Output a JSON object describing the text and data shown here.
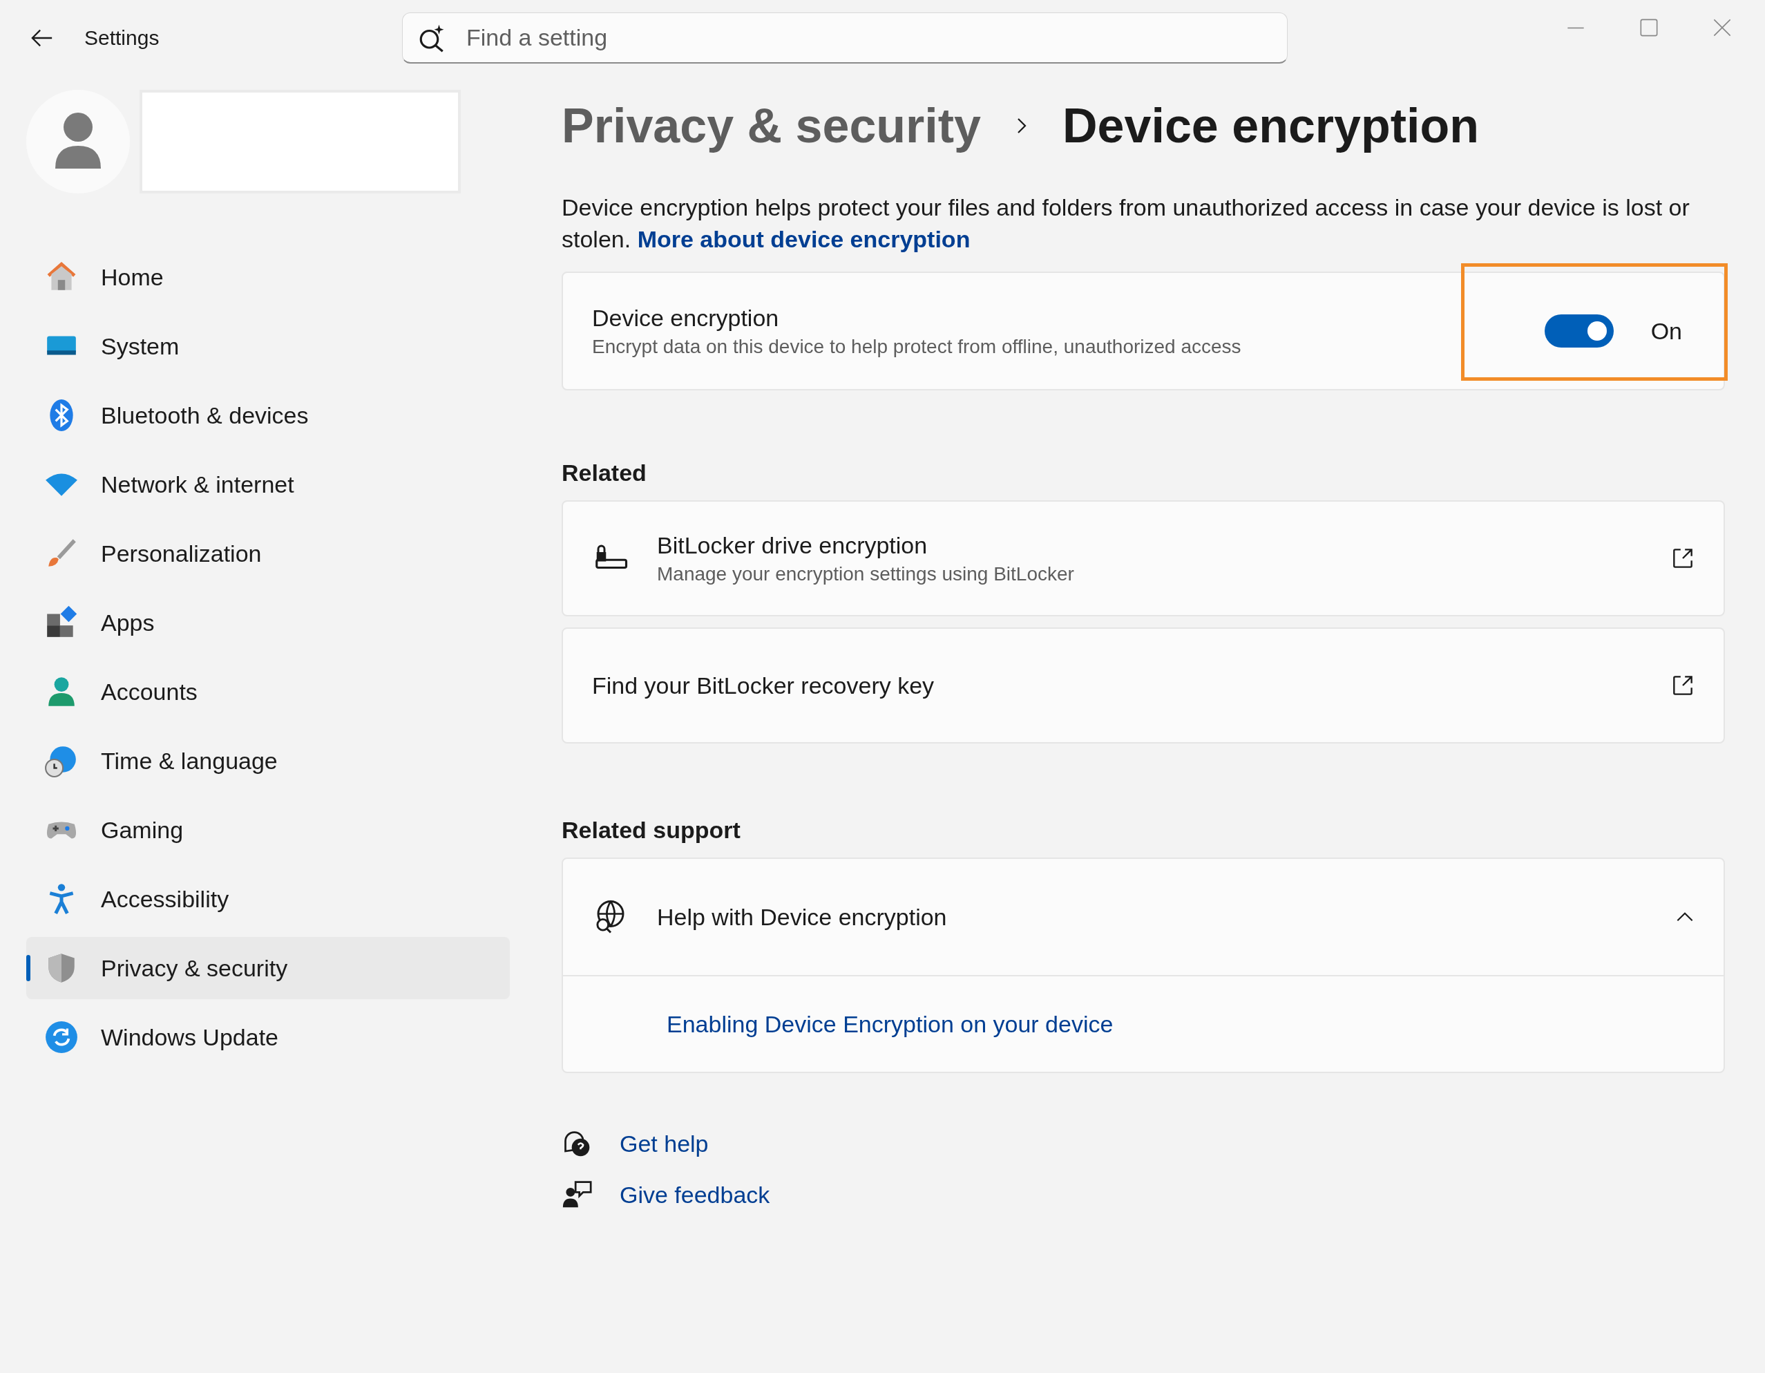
{
  "app_title": "Settings",
  "search": {
    "placeholder": "Find a setting"
  },
  "sidebar": {
    "items": [
      {
        "label": "Home",
        "selected": false
      },
      {
        "label": "System",
        "selected": false
      },
      {
        "label": "Bluetooth & devices",
        "selected": false
      },
      {
        "label": "Network & internet",
        "selected": false
      },
      {
        "label": "Personalization",
        "selected": false
      },
      {
        "label": "Apps",
        "selected": false
      },
      {
        "label": "Accounts",
        "selected": false
      },
      {
        "label": "Time & language",
        "selected": false
      },
      {
        "label": "Gaming",
        "selected": false
      },
      {
        "label": "Accessibility",
        "selected": false
      },
      {
        "label": "Privacy & security",
        "selected": true
      },
      {
        "label": "Windows Update",
        "selected": false
      }
    ]
  },
  "breadcrumb": {
    "parent": "Privacy & security",
    "current": "Device encryption"
  },
  "description": {
    "text": "Device encryption helps protect your files and folders from unauthorized access in case your device is lost or stolen.",
    "link": "More about device encryption"
  },
  "encryption_setting": {
    "title": "Device encryption",
    "subtitle": "Encrypt data on this device to help protect from offline, unauthorized access",
    "on": true,
    "state_label": "On",
    "highlighted": true
  },
  "related": {
    "heading": "Related",
    "items": [
      {
        "kind": "detailed",
        "title": "BitLocker drive encryption",
        "subtitle": "Manage your encryption settings using BitLocker"
      },
      {
        "kind": "simple",
        "title": "Find your BitLocker recovery key"
      }
    ]
  },
  "related_support": {
    "heading": "Related support",
    "expander": {
      "title": "Help with Device encryption",
      "expanded": true,
      "links": [
        "Enabling Device Encryption on your device"
      ]
    }
  },
  "footer_links": [
    {
      "label": "Get help"
    },
    {
      "label": "Give feedback"
    }
  ]
}
